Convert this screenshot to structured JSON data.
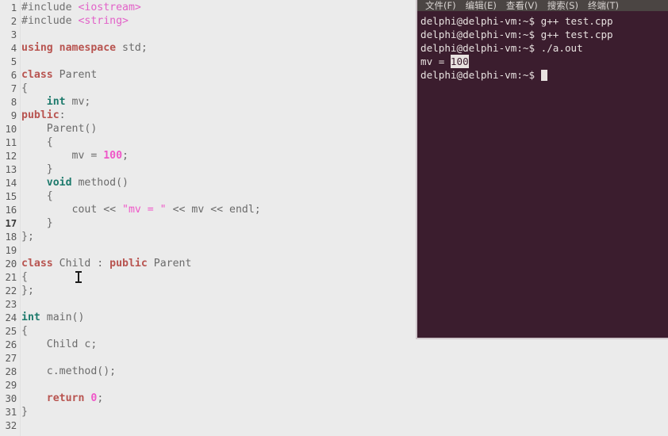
{
  "editor": {
    "name": "code-editor",
    "background": "#ebebeb",
    "language": "C++",
    "current_line": 17,
    "lines": [
      {
        "num": "1",
        "tokens": [
          {
            "t": "#include ",
            "c": "t-pre"
          },
          {
            "t": "<iostream>",
            "c": "t-inc"
          }
        ]
      },
      {
        "num": "2",
        "tokens": [
          {
            "t": "#include ",
            "c": "t-pre"
          },
          {
            "t": "<string>",
            "c": "t-inc"
          }
        ]
      },
      {
        "num": "3",
        "tokens": []
      },
      {
        "num": "4",
        "tokens": [
          {
            "t": "using namespace",
            "c": "t-kw"
          },
          {
            "t": " std;",
            "c": "t-id"
          }
        ]
      },
      {
        "num": "5",
        "tokens": []
      },
      {
        "num": "6",
        "tokens": [
          {
            "t": "class",
            "c": "t-kw"
          },
          {
            "t": " Parent",
            "c": "t-id"
          }
        ]
      },
      {
        "num": "7",
        "tokens": [
          {
            "t": "{",
            "c": "t-punc"
          }
        ]
      },
      {
        "num": "8",
        "tokens": [
          {
            "t": "    ",
            "c": "t-id"
          },
          {
            "t": "int",
            "c": "t-type"
          },
          {
            "t": " mv;",
            "c": "t-id"
          }
        ]
      },
      {
        "num": "9",
        "tokens": [
          {
            "t": "public",
            "c": "t-kw"
          },
          {
            "t": ":",
            "c": "t-punc"
          }
        ]
      },
      {
        "num": "10",
        "tokens": [
          {
            "t": "    Parent()",
            "c": "t-id"
          }
        ]
      },
      {
        "num": "11",
        "tokens": [
          {
            "t": "    {",
            "c": "t-punc"
          }
        ]
      },
      {
        "num": "12",
        "tokens": [
          {
            "t": "        mv = ",
            "c": "t-id"
          },
          {
            "t": "100",
            "c": "t-num"
          },
          {
            "t": ";",
            "c": "t-punc"
          }
        ]
      },
      {
        "num": "13",
        "tokens": [
          {
            "t": "    }",
            "c": "t-punc"
          }
        ]
      },
      {
        "num": "14",
        "tokens": [
          {
            "t": "    ",
            "c": "t-id"
          },
          {
            "t": "void",
            "c": "t-type"
          },
          {
            "t": " method()",
            "c": "t-id"
          }
        ]
      },
      {
        "num": "15",
        "tokens": [
          {
            "t": "    {",
            "c": "t-punc"
          }
        ]
      },
      {
        "num": "16",
        "tokens": [
          {
            "t": "        cout << ",
            "c": "t-id"
          },
          {
            "t": "\"mv = \"",
            "c": "t-str"
          },
          {
            "t": " << mv << endl;",
            "c": "t-id"
          }
        ]
      },
      {
        "num": "17",
        "tokens": [
          {
            "t": "    }",
            "c": "t-punc"
          }
        ]
      },
      {
        "num": "18",
        "tokens": [
          {
            "t": "};",
            "c": "t-punc"
          }
        ]
      },
      {
        "num": "19",
        "tokens": []
      },
      {
        "num": "20",
        "tokens": [
          {
            "t": "class",
            "c": "t-kw"
          },
          {
            "t": " Child : ",
            "c": "t-id"
          },
          {
            "t": "public",
            "c": "t-kw"
          },
          {
            "t": " Parent",
            "c": "t-id"
          }
        ]
      },
      {
        "num": "21",
        "tokens": [
          {
            "t": "{",
            "c": "t-punc"
          }
        ]
      },
      {
        "num": "22",
        "tokens": [
          {
            "t": "};",
            "c": "t-punc"
          }
        ]
      },
      {
        "num": "23",
        "tokens": []
      },
      {
        "num": "24",
        "tokens": [
          {
            "t": "int",
            "c": "t-type"
          },
          {
            "t": " main()",
            "c": "t-id"
          }
        ]
      },
      {
        "num": "25",
        "tokens": [
          {
            "t": "{",
            "c": "t-punc"
          }
        ]
      },
      {
        "num": "26",
        "tokens": [
          {
            "t": "    Child c;",
            "c": "t-id"
          }
        ]
      },
      {
        "num": "27",
        "tokens": []
      },
      {
        "num": "28",
        "tokens": [
          {
            "t": "    c.method();",
            "c": "t-id"
          }
        ]
      },
      {
        "num": "29",
        "tokens": []
      },
      {
        "num": "30",
        "tokens": [
          {
            "t": "    ",
            "c": "t-id"
          },
          {
            "t": "return",
            "c": "t-kw"
          },
          {
            "t": " ",
            "c": "t-id"
          },
          {
            "t": "0",
            "c": "t-num"
          },
          {
            "t": ";",
            "c": "t-punc"
          }
        ]
      },
      {
        "num": "31",
        "tokens": [
          {
            "t": "}",
            "c": "t-punc"
          }
        ]
      },
      {
        "num": "32",
        "tokens": []
      }
    ]
  },
  "terminal": {
    "background": "#3b1d2e",
    "foreground": "#e8e2e0",
    "menubar": [
      {
        "label": "文件(F)"
      },
      {
        "label": "编辑(E)"
      },
      {
        "label": "查看(V)"
      },
      {
        "label": "搜索(S)"
      },
      {
        "label": "终端(T)"
      }
    ],
    "lines": [
      {
        "segments": [
          {
            "text": "delphi@delphi-vm:~$ g++ test.cpp",
            "highlight": false
          }
        ]
      },
      {
        "segments": [
          {
            "text": "delphi@delphi-vm:~$ g++ test.cpp",
            "highlight": false
          }
        ]
      },
      {
        "segments": [
          {
            "text": "delphi@delphi-vm:~$ ./a.out",
            "highlight": false
          }
        ]
      },
      {
        "segments": [
          {
            "text": "mv = ",
            "highlight": false
          },
          {
            "text": "100",
            "highlight": true
          }
        ]
      },
      {
        "segments": [
          {
            "text": "delphi@delphi-vm:~$ ",
            "highlight": false
          }
        ],
        "cursor": true
      }
    ]
  }
}
